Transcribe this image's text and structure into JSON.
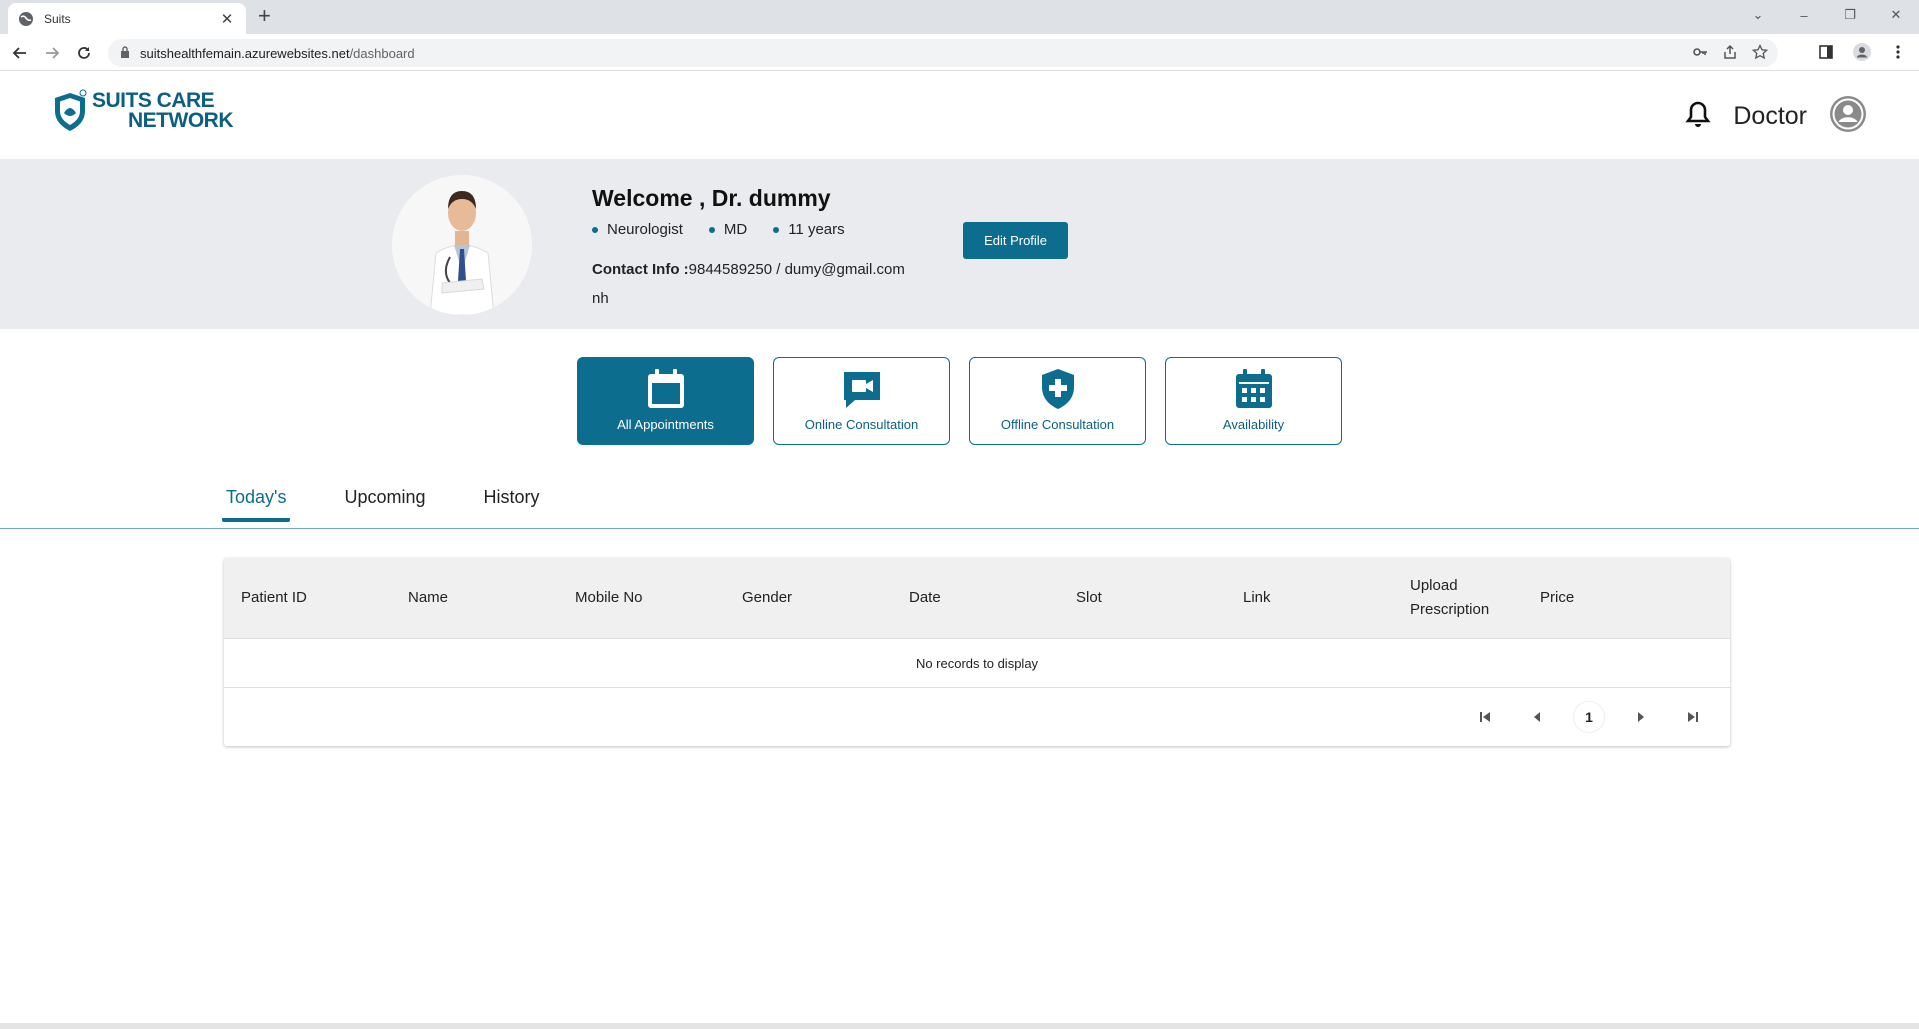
{
  "browser": {
    "tab_title": "Suits",
    "url_host": "suitshealthfemain.azurewebsites.net",
    "url_path": "/dashboard"
  },
  "header": {
    "logo_line1": "SUITS CARE",
    "logo_line2": "NETWORK",
    "role": "Doctor"
  },
  "profile": {
    "welcome": "Welcome , Dr. dummy",
    "qualifications": [
      "Neurologist",
      "MD",
      "11 years"
    ],
    "contact_label": "Contact Info :",
    "contact_value": "9844589250 / dumy@gmail.com",
    "note": "nh",
    "edit_button": "Edit Profile"
  },
  "cards": [
    {
      "label": "All Appointments",
      "icon": "calendar-icon",
      "active": true
    },
    {
      "label": "Online Consultation",
      "icon": "video-chat-icon",
      "active": false
    },
    {
      "label": "Offline Consultation",
      "icon": "shield-plus-icon",
      "active": false
    },
    {
      "label": "Availability",
      "icon": "calendar-grid-icon",
      "active": false
    }
  ],
  "tabs": [
    {
      "label": "Today's",
      "active": true
    },
    {
      "label": "Upcoming",
      "active": false
    },
    {
      "label": "History",
      "active": false
    }
  ],
  "table": {
    "columns": [
      "Patient ID",
      "Name",
      "Mobile No",
      "Gender",
      "Date",
      "Slot",
      "Link",
      "Upload Prescription",
      "Price"
    ],
    "empty_message": "No records to display",
    "current_page": "1"
  },
  "colors": {
    "primary": "#0c6d8e",
    "banner_bg": "#e9ebee"
  }
}
